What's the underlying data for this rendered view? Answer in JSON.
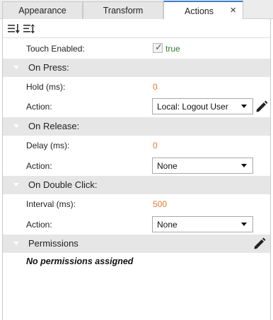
{
  "tabs": [
    {
      "label": "Appearance"
    },
    {
      "label": "Transform"
    },
    {
      "label": "Actions"
    }
  ],
  "touch": {
    "label": "Touch Enabled:",
    "checked": true,
    "value_text": "true"
  },
  "on_press": {
    "title": "On Press:",
    "hold_label": "Hold (ms):",
    "hold_value": "0",
    "action_label": "Action:",
    "action_value": "Local: Logout User"
  },
  "on_release": {
    "title": "On Release:",
    "delay_label": "Delay (ms):",
    "delay_value": "0",
    "action_label": "Action:",
    "action_value": "None"
  },
  "on_double_click": {
    "title": "On Double Click:",
    "interval_label": "Interval (ms):",
    "interval_value": "500",
    "action_label": "Action:",
    "action_value": "None"
  },
  "permissions": {
    "title": "Permissions",
    "empty_text": "No permissions assigned"
  },
  "icons": {
    "tab_close": "close-icon",
    "toolbar_1": "sort-descending-icon",
    "toolbar_2": "sort-options-icon",
    "edit": "pencil-icon"
  },
  "colors": {
    "accent": "#3c7fd1",
    "value_orange": "#e07b2e",
    "value_green": "#2e7d32",
    "section_bg": "#e6e6e6"
  }
}
